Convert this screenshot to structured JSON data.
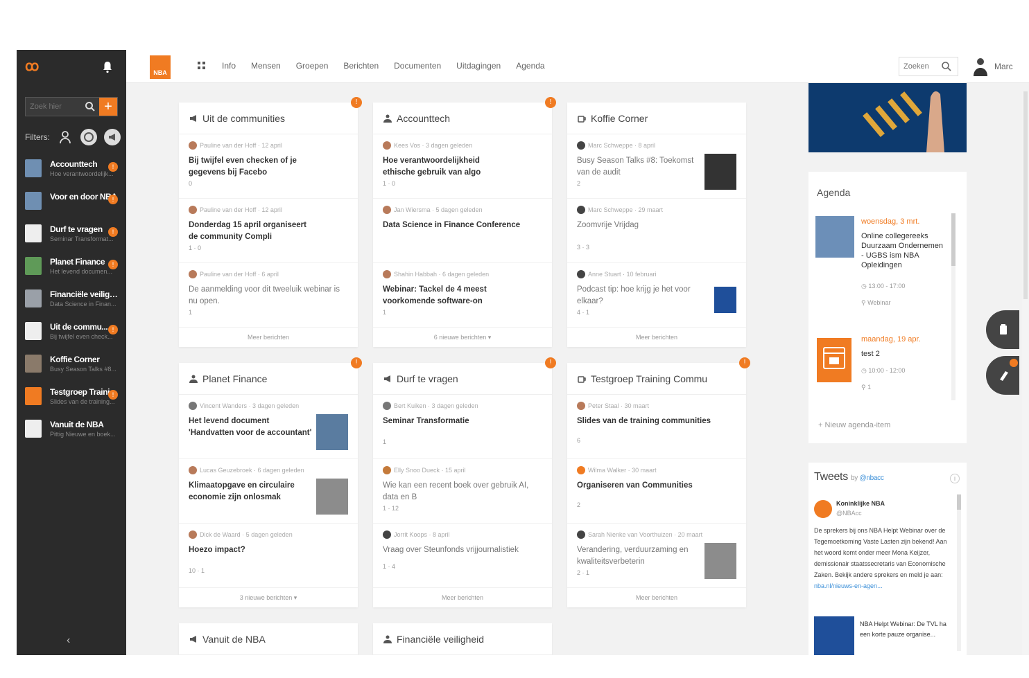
{
  "sidebar": {
    "search_placeholder": "Zoek hier",
    "add_label": "+",
    "filters_label": "Filters:",
    "collapse_label": "‹",
    "items": [
      {
        "title": "Accounttech",
        "sub": "Hoe verantwoordelijk...",
        "badge": "!"
      },
      {
        "title": "Voor en door NBA",
        "sub": "",
        "badge": "!"
      },
      {
        "title": "Durf te vragen",
        "sub": "Seminar Transformat...",
        "badge": "!"
      },
      {
        "title": "Planet Finance",
        "sub": "Het levend documen...",
        "badge": "!"
      },
      {
        "title": "Financiële veiligh...",
        "sub": "Data Science in Finan...",
        "badge": ""
      },
      {
        "title": "Uit de commu...",
        "sub": "Bij twijfel even check...",
        "badge": "!"
      },
      {
        "title": "Koffie Corner",
        "sub": "Busy Season Talks #8...",
        "badge": ""
      },
      {
        "title": "Testgroep Trainin...",
        "sub": "Slides van de training...",
        "badge": "!"
      },
      {
        "title": "Vanuit de NBA",
        "sub": "Pittig Nieuwe en boek...",
        "badge": ""
      }
    ]
  },
  "topbar": {
    "logo_text": "NBA",
    "nav": [
      "Info",
      "Mensen",
      "Groepen",
      "Berichten",
      "Documenten",
      "Uitdagingen",
      "Agenda"
    ],
    "search_placeholder": "Zoeken",
    "username": "Marc"
  },
  "cards": [
    {
      "title": "Uit de communities",
      "badge": "!",
      "posts": [
        {
          "meta": "Pauline van der Hoff · 12 april",
          "title": "Bij twijfel even checken of je gegevens bij Facebo",
          "stats": "0",
          "light": false
        },
        {
          "meta": "Pauline van der Hoff · 12 april",
          "title": "Donderdag 15 april organiseert de community Compli",
          "stats": "1 · 0",
          "light": false
        },
        {
          "meta": "Pauline van der Hoff · 6 april",
          "title": "De aanmelding voor dit tweeluik webinar is nu open.",
          "stats": "1",
          "light": true
        }
      ],
      "footer": "Meer berichten"
    },
    {
      "title": "Accounttech",
      "badge": "!",
      "posts": [
        {
          "meta": "Kees Vos · 3 dagen geleden",
          "title": "Hoe verantwoordelijkheid ethische gebruik van algo",
          "stats": "1 · 0",
          "light": false
        },
        {
          "meta": "Jan Wiersma · 5 dagen geleden",
          "title": "Data Science in Finance Conference",
          "stats": "",
          "light": false
        },
        {
          "meta": "Shahin Habbah · 6 dagen geleden",
          "title": "Webinar: Tackel de 4 meest voorkomende software-on",
          "stats": "1",
          "light": false
        }
      ],
      "footer": "6 nieuwe berichten ▾"
    },
    {
      "title": "Koffie Corner",
      "badge": "",
      "posts": [
        {
          "meta": "Marc Schweppe · 8 april",
          "title": "Busy Season Talks #8: Toekomst van de audit",
          "stats": "2",
          "light": true
        },
        {
          "meta": "Marc Schweppe · 29 maart",
          "title": "Zoomvrije Vrijdag",
          "stats": "3 · 3",
          "light": true
        },
        {
          "meta": "Anne Stuart · 10 februari",
          "title": "Podcast tip: hoe krijg je het voor elkaar?",
          "stats": "4 · 1",
          "light": true
        }
      ],
      "footer": "Meer berichten"
    },
    {
      "title": "Planet Finance",
      "badge": "!",
      "posts": [
        {
          "meta": "Vincent Wanders · 3 dagen geleden",
          "title": "Het levend document 'Handvatten voor de accountant'",
          "stats": "",
          "light": false
        },
        {
          "meta": "Lucas Geuzebroek · 6 dagen geleden",
          "title": "Klimaatopgave en circulaire economie zijn onlosmak",
          "stats": "",
          "light": false
        },
        {
          "meta": "Dick de Waard · 5 dagen geleden",
          "title": "Hoezo impact?",
          "stats": "10 · 1",
          "light": false
        }
      ],
      "footer": "3 nieuwe berichten ▾"
    },
    {
      "title": "Durf te vragen",
      "badge": "!",
      "posts": [
        {
          "meta": "Bert Kuiken · 3 dagen geleden",
          "title": "Seminar Transformatie",
          "stats": "1",
          "light": false
        },
        {
          "meta": "Elly Snoo Dueck · 15 april",
          "title": "Wie kan een recent boek over gebruik AI, data en B",
          "stats": "1 · 12",
          "light": true
        },
        {
          "meta": "Jorrit Koops · 8 april",
          "title": "Vraag over Steunfonds vrijjournalistiek",
          "stats": "1 · 4",
          "light": true
        }
      ],
      "footer": "Meer berichten"
    },
    {
      "title": "Testgroep Training Commu",
      "badge": "!",
      "posts": [
        {
          "meta": "Peter Staal · 30 maart",
          "title": "Slides van de training communities",
          "stats": "6",
          "light": false
        },
        {
          "meta": "Wilma Walker · 30 maart",
          "title": "Organiseren van Communities",
          "stats": "2",
          "light": false
        },
        {
          "meta": "Sarah Nienke van Voorthuizen · 20 maart",
          "title": "Verandering, verduurzaming en kwaliteitsverbeterin",
          "stats": "2 · 1",
          "light": true
        }
      ],
      "footer": "Meer berichten"
    },
    {
      "title": "Vanuit de NBA",
      "badge": "",
      "posts": [],
      "footer": ""
    },
    {
      "title": "Financiële veiligheid",
      "badge": "",
      "posts": [],
      "footer": ""
    }
  ],
  "agenda": {
    "title": "Agenda",
    "items": [
      {
        "date": "woensdag, 3 mrt.",
        "name": "Online collegereeks Duurzaam Ondernemen - UGBS ism NBA Opleidingen",
        "time": "13:00 - 17:00",
        "location": "Webinar"
      },
      {
        "date": "maandag, 19 apr.",
        "name": "test 2",
        "time": "10:00 - 12:00",
        "location": "1"
      }
    ],
    "add_label": "+ Nieuw agenda-item"
  },
  "tweets": {
    "title": "Tweets",
    "by": "by",
    "handle": "@nbacc",
    "author": "Koninklijke NBA",
    "author_handle": "@NBAcc",
    "text": "De sprekers bij ons NBA Helpt Webinar over de Tegemoetkoming Vaste Lasten zijn bekend! Aan het woord komt onder meer Mona Keijzer, demissionair staatssecretaris van Economische Zaken. Bekijk andere sprekers en meld je aan:",
    "link": "nba.nl/nieuws-en-agen...",
    "card_text": "NBA Helpt Webinar: De TVL ha een korte pauze organise..."
  },
  "colors": {
    "accent": "#f07b22",
    "sidebar_bg": "#2b2b2b",
    "page_bg": "#f2f2f2"
  }
}
